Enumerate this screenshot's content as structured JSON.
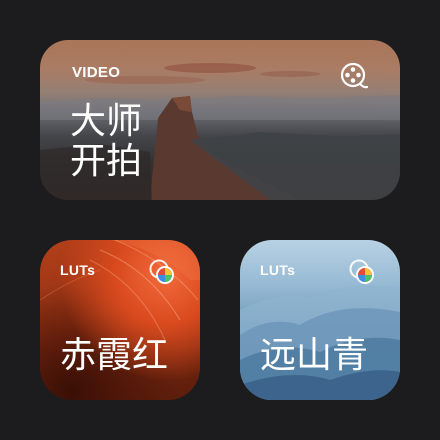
{
  "widgets": {
    "video": {
      "tag": "VIDEO",
      "title_line1": "大师",
      "title_line2": "开拍",
      "icon": "film-reel-icon"
    },
    "lut_red": {
      "tag": "LUTs",
      "title": "赤霞红",
      "icon": "color-palette-icon"
    },
    "lut_blue": {
      "tag": "LUTs",
      "title": "远山青",
      "icon": "color-palette-icon"
    }
  },
  "colors": {
    "background": "#1c1c1e",
    "red_accent": "#d94a1e",
    "blue_accent": "#6e98ba",
    "text": "#ffffff"
  }
}
